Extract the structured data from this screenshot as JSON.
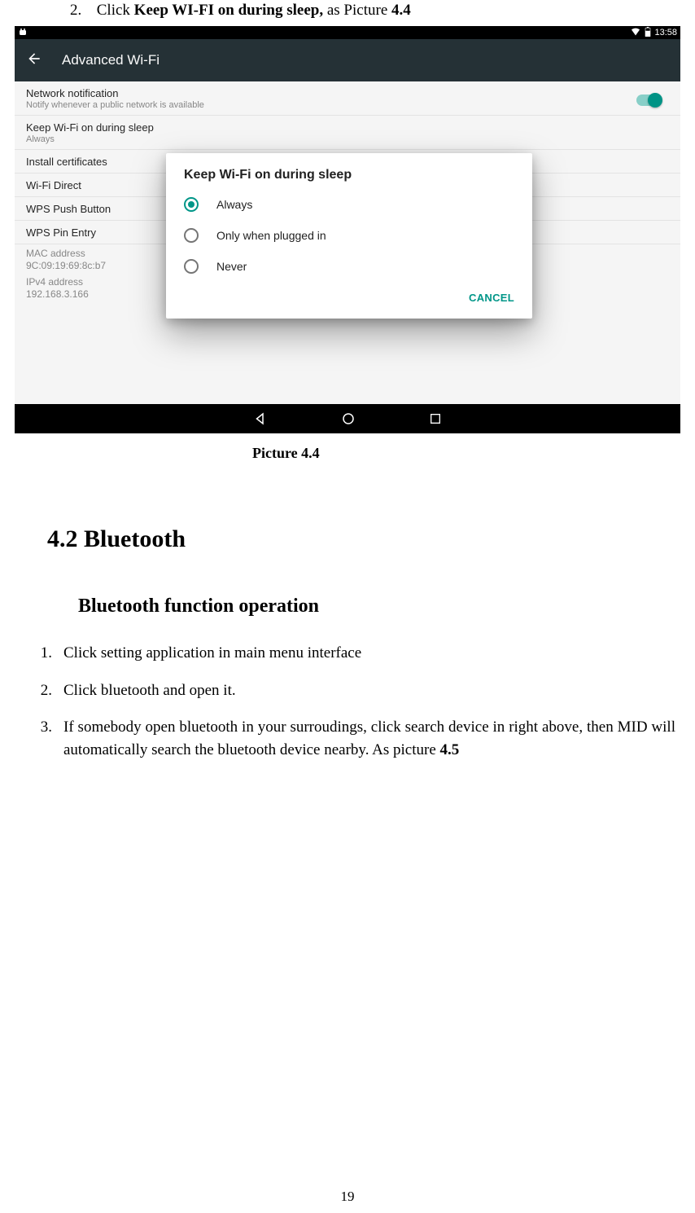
{
  "doc": {
    "top_instruction_num": "2.",
    "top_instruction_prefix": "Click ",
    "top_instruction_bold": "Keep WI-FI on during sleep,",
    "top_instruction_suffix": " as Picture ",
    "top_instruction_ref": "4.4",
    "caption": "Picture 4.4",
    "section_heading": "4.2    Bluetooth",
    "sub_heading": "Bluetooth function operation",
    "steps": [
      {
        "num": "1.",
        "text": "Click setting application in main menu interface"
      },
      {
        "num": "2.",
        "text": "Click bluetooth and open it."
      },
      {
        "num": "3.",
        "text_prefix": "If somebody open bluetooth in your surroudings, click search device in right above, then MID will automatically search the bluetooth device nearby. As picture ",
        "ref": "4.5"
      }
    ],
    "page_number": "19"
  },
  "screenshot": {
    "statusbar": {
      "time": "13:58"
    },
    "appbar": {
      "title": "Advanced Wi-Fi"
    },
    "settings": {
      "network_notification": {
        "title": "Network notification",
        "sub": "Notify whenever a public network is available"
      },
      "keep_wifi": {
        "title": "Keep Wi-Fi on during sleep",
        "sub": "Always"
      },
      "install_certs": {
        "title": "Install certificates"
      },
      "wifi_direct": {
        "title": "Wi-Fi Direct"
      },
      "wps_push": {
        "title": "WPS Push Button"
      },
      "wps_pin": {
        "title": "WPS Pin Entry"
      },
      "mac": {
        "title": "MAC address",
        "value": "9C:09:19:69:8c:b7"
      },
      "ipv4": {
        "title": "IPv4 address",
        "value": "192.168.3.166"
      }
    },
    "dialog": {
      "title": "Keep Wi-Fi on during sleep",
      "options": {
        "always": "Always",
        "plugged": "Only when plugged in",
        "never": "Never"
      },
      "cancel": "CANCEL"
    }
  }
}
